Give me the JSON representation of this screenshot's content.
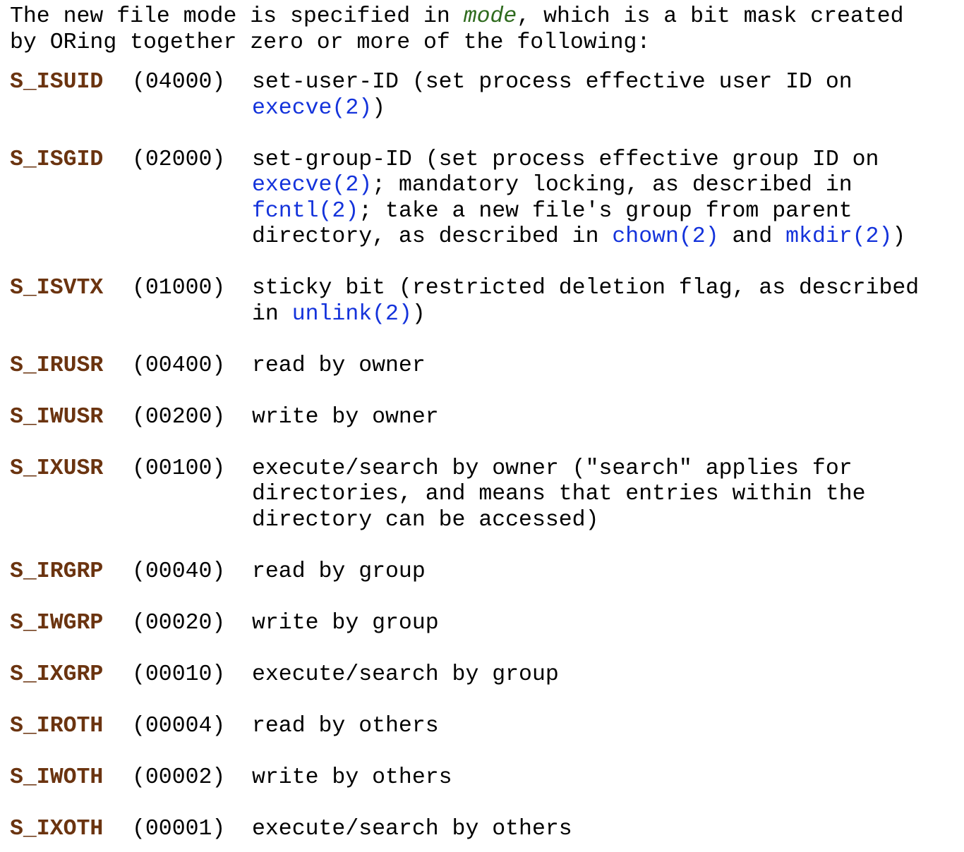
{
  "document": {
    "intro": {
      "segments": [
        {
          "text": "The new file mode is specified in ",
          "style": "plain"
        },
        {
          "text": "mode",
          "style": "param"
        },
        {
          "text": ", which is a bit mask created\nby ORing together zero or more of the following:",
          "style": "plain"
        }
      ],
      "plain_text": "The new file mode is specified in mode, which is a bit mask created by ORing together zero or more of the following:"
    },
    "colors": {
      "background": "#ffffff",
      "text": "#000000",
      "constant_name": "#6b3410",
      "link": "#1433db",
      "parameter": "#2f6b1e"
    },
    "entries": [
      {
        "name": "S_ISUID",
        "octal": "(04000)",
        "lines": [
          [
            {
              "text": "set-user-ID (set process effective user ID on",
              "style": "plain"
            }
          ],
          [
            {
              "text": "execve(2)",
              "style": "link"
            },
            {
              "text": ")",
              "style": "plain"
            }
          ]
        ],
        "description_text": "set-user-ID (set process effective user ID on execve(2))"
      },
      {
        "name": "S_ISGID",
        "octal": "(02000)",
        "lines": [
          [
            {
              "text": "set-group-ID (set process effective group ID on",
              "style": "plain"
            }
          ],
          [
            {
              "text": "execve(2)",
              "style": "link"
            },
            {
              "text": "; mandatory locking, as described in",
              "style": "plain"
            }
          ],
          [
            {
              "text": "fcntl(2)",
              "style": "link"
            },
            {
              "text": "; take a new file's group from parent",
              "style": "plain"
            }
          ],
          [
            {
              "text": "directory, as described in ",
              "style": "plain"
            },
            {
              "text": "chown(2)",
              "style": "link"
            },
            {
              "text": " and ",
              "style": "plain"
            },
            {
              "text": "mkdir(2)",
              "style": "link"
            },
            {
              "text": ")",
              "style": "plain"
            }
          ]
        ],
        "description_text": "set-group-ID (set process effective group ID on execve(2); mandatory locking, as described in fcntl(2); take a new file's group from parent directory, as described in chown(2) and mkdir(2))"
      },
      {
        "name": "S_ISVTX",
        "octal": "(01000)",
        "lines": [
          [
            {
              "text": "sticky bit (restricted deletion flag, as described",
              "style": "plain"
            }
          ],
          [
            {
              "text": "in ",
              "style": "plain"
            },
            {
              "text": "unlink(2)",
              "style": "link"
            },
            {
              "text": ")",
              "style": "plain"
            }
          ]
        ],
        "description_text": "sticky bit (restricted deletion flag, as described in unlink(2))"
      },
      {
        "name": "S_IRUSR",
        "octal": "(00400)",
        "lines": [
          [
            {
              "text": "read by owner",
              "style": "plain"
            }
          ]
        ],
        "description_text": "read by owner"
      },
      {
        "name": "S_IWUSR",
        "octal": "(00200)",
        "lines": [
          [
            {
              "text": "write by owner",
              "style": "plain"
            }
          ]
        ],
        "description_text": "write by owner"
      },
      {
        "name": "S_IXUSR",
        "octal": "(00100)",
        "lines": [
          [
            {
              "text": "execute/search by owner (\"search\" applies for",
              "style": "plain"
            }
          ],
          [
            {
              "text": "directories, and means that entries within the",
              "style": "plain"
            }
          ],
          [
            {
              "text": "directory can be accessed)",
              "style": "plain"
            }
          ]
        ],
        "description_text": "execute/search by owner (\"search\" applies for directories, and means that entries within the directory can be accessed)"
      },
      {
        "name": "S_IRGRP",
        "octal": "(00040)",
        "lines": [
          [
            {
              "text": "read by group",
              "style": "plain"
            }
          ]
        ],
        "description_text": "read by group"
      },
      {
        "name": "S_IWGRP",
        "octal": "(00020)",
        "lines": [
          [
            {
              "text": "write by group",
              "style": "plain"
            }
          ]
        ],
        "description_text": "write by group"
      },
      {
        "name": "S_IXGRP",
        "octal": "(00010)",
        "lines": [
          [
            {
              "text": "execute/search by group",
              "style": "plain"
            }
          ]
        ],
        "description_text": "execute/search by group"
      },
      {
        "name": "S_IROTH",
        "octal": "(00004)",
        "lines": [
          [
            {
              "text": "read by others",
              "style": "plain"
            }
          ]
        ],
        "description_text": "read by others"
      },
      {
        "name": "S_IWOTH",
        "octal": "(00002)",
        "lines": [
          [
            {
              "text": "write by others",
              "style": "plain"
            }
          ]
        ],
        "description_text": "write by others"
      },
      {
        "name": "S_IXOTH",
        "octal": "(00001)",
        "lines": [
          [
            {
              "text": "execute/search by others",
              "style": "plain"
            }
          ]
        ],
        "description_text": "execute/search by others"
      }
    ]
  }
}
